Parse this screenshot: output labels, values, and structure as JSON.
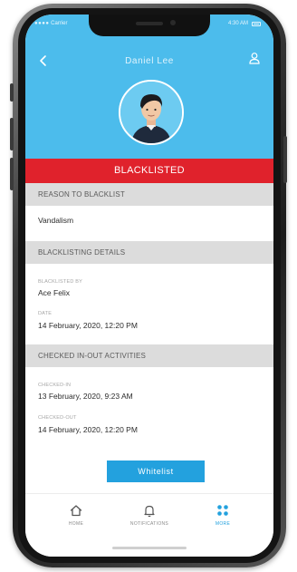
{
  "status_bar": {
    "carrier": "Carrier",
    "time": "4:30 AM"
  },
  "header": {
    "title": "Daniel Lee"
  },
  "banner": {
    "text": "BLACKLISTED"
  },
  "reason": {
    "heading": "REASON TO BLACKLIST",
    "value": "Vandalism"
  },
  "details": {
    "heading": "BLACKLISTING DETAILS",
    "blacklisted_by_label": "BLACKLISTED BY",
    "blacklisted_by_value": "Ace Felix",
    "date_label": "DATE",
    "date_value": "14 February, 2020, 12:20 PM"
  },
  "activities": {
    "heading": "CHECKED IN-OUT ACTIVITIES",
    "checked_in_label": "CHECKED-IN",
    "checked_in_value": "13 February, 2020, 9:23 AM",
    "checked_out_label": "CHECKED-OUT",
    "checked_out_value": "14 February, 2020, 12:20 PM"
  },
  "actions": {
    "whitelist_label": "Whitelist"
  },
  "tabbar": {
    "home": "HOME",
    "notifications": "NOTIFICATIONS",
    "more": "MORE",
    "active": "more"
  },
  "colors": {
    "header": "#4cbcec",
    "banner": "#e0222c",
    "accent": "#23a1de",
    "section": "#dcdcdc"
  },
  "icons": [
    "back-icon",
    "user-icon",
    "home-icon",
    "bell-icon",
    "grid-icon"
  ]
}
